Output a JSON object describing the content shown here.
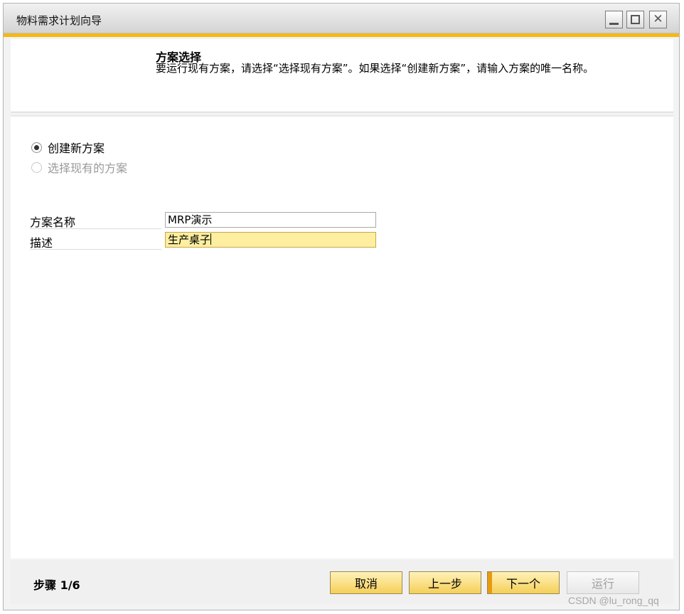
{
  "window": {
    "title": "物料需求计划向导"
  },
  "header": {
    "title": "方案选择",
    "description": "要运行现有方案，请选择“选择现有方案”。如果选择“创建新方案”，请输入方案的唯一名称。"
  },
  "options": [
    {
      "label": "创建新方案",
      "selected": true,
      "enabled": true
    },
    {
      "label": "选择现有的方案",
      "selected": false,
      "enabled": false
    }
  ],
  "fields": {
    "name": {
      "label": "方案名称",
      "value": "MRP演示"
    },
    "description": {
      "label": "描述",
      "value": "生产桌子"
    }
  },
  "footer": {
    "step": "步骤 1/6",
    "cancel": "取消",
    "prev": "上一步",
    "next": "下一个",
    "run": "运行"
  },
  "watermark": "CSDN @lu_rong_qq",
  "colors": {
    "accent": "#f6b816",
    "button": "#f4cf5a",
    "active_field": "#fdeea0"
  }
}
